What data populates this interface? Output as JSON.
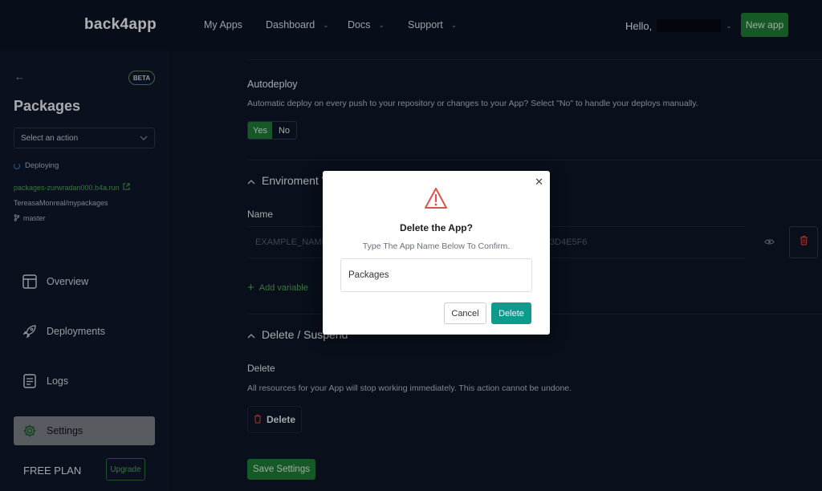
{
  "nav": {
    "brand": "back4app",
    "links": [
      {
        "label": "My Apps",
        "has_dropdown": false
      },
      {
        "label": "Dashboard",
        "has_dropdown": true
      },
      {
        "label": "Docs",
        "has_dropdown": true
      },
      {
        "label": "Support",
        "has_dropdown": true
      }
    ],
    "greeting": "Hello,",
    "new_app_label": "New app"
  },
  "sidebar": {
    "beta_label": "BETA",
    "title": "Packages",
    "action_select_placeholder": "Select an action",
    "status": "Deploying",
    "app_url": "packages-zurwradan000.b4a.run",
    "repo": "TereasaMonreal/mypackages",
    "branch": "master",
    "menu": [
      {
        "label": "Overview",
        "icon": "layout-icon",
        "active": false
      },
      {
        "label": "Deployments",
        "icon": "rocket-icon",
        "active": false
      },
      {
        "label": "Logs",
        "icon": "document-icon",
        "active": false
      },
      {
        "label": "Settings",
        "icon": "gear-icon",
        "active": true
      }
    ],
    "plan_label": "FREE PLAN",
    "upgrade_label": "Upgrade"
  },
  "main": {
    "autodeploy": {
      "title": "Autodeploy",
      "description": "Automatic deploy on every push to your repository or changes to your App? Select \"No\" to handle your deploys manually.",
      "yes_label": "Yes",
      "no_label": "No",
      "selected": "Yes"
    },
    "env": {
      "section_title": "Enviroment V",
      "name_header": "Name",
      "name_placeholder": "EXAMPLE_NAME",
      "value_placeholder": "C3D4E5F6",
      "add_variable_label": "Add variable"
    },
    "delete_section": {
      "section_title": "Delete / Suspend",
      "title": "Delete",
      "description": "All resources for your App will stop working immediately. This action cannot be undone.",
      "button_label": "Delete"
    },
    "save_label": "Save Settings"
  },
  "modal": {
    "title": "Delete the App?",
    "subtitle": "Type The App Name Below To Confirm.",
    "input_value": "Packages",
    "cancel_label": "Cancel",
    "confirm_label": "Delete"
  },
  "colors": {
    "accent_green": "#1f7a35",
    "link_green": "#4fa25c",
    "teal": "#0f9a8e",
    "warning_red": "#d9534f",
    "bg": "#0d1526"
  }
}
